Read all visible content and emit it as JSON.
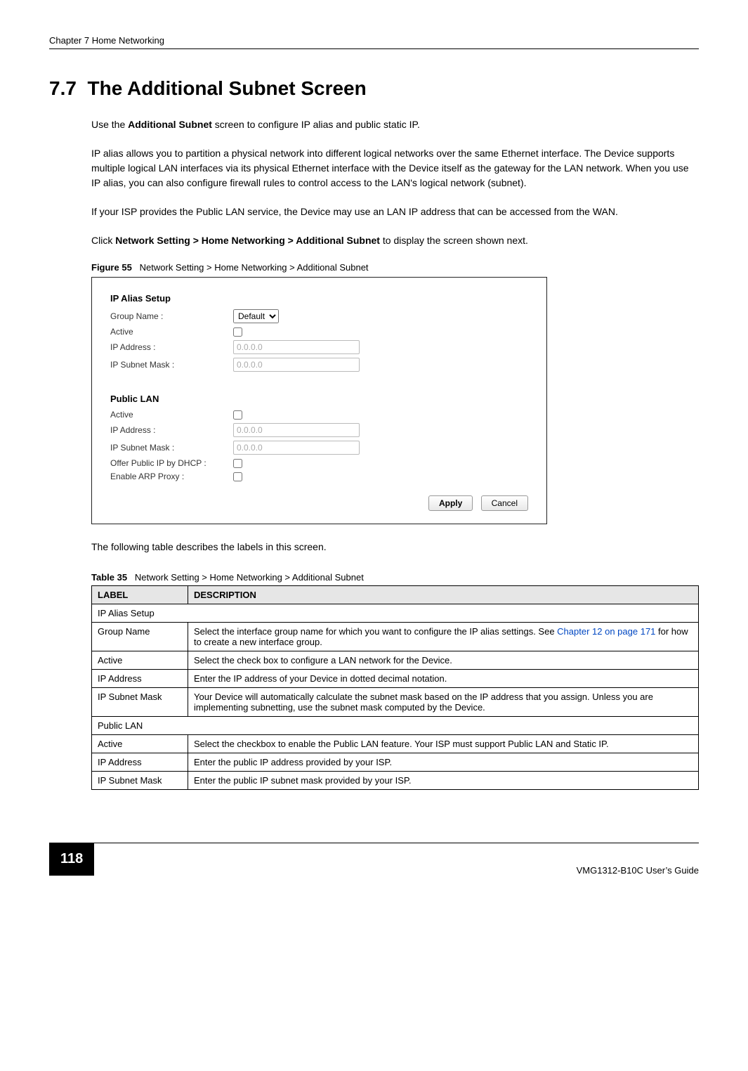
{
  "header": {
    "chapter": "Chapter 7 Home Networking"
  },
  "section": {
    "number": "7.7",
    "title": "The Additional Subnet Screen"
  },
  "paras": {
    "p1a": "Use the ",
    "p1b": "Additional Subnet",
    "p1c": " screen to configure IP alias and public static IP.",
    "p2": "IP alias allows you to partition a physical network into different logical networks over the same Ethernet interface. The Device supports multiple logical LAN interfaces via its physical Ethernet interface with the Device itself as the gateway for the LAN network. When you use IP alias, you can also configure firewall rules to control access to the LAN's logical network (subnet).",
    "p3": "If your ISP provides the Public LAN service, the Device may use an LAN IP address that can be accessed from the WAN.",
    "p4a": "Click ",
    "p4b": "Network Setting > Home Networking > Additional Subnet",
    "p4c": " to display the screen shown next.",
    "after_fig": "The following table describes the labels in this screen."
  },
  "figure": {
    "label": "Figure 55",
    "caption": "Network Setting > Home Networking > Additional Subnet"
  },
  "screenshot": {
    "ipalias": {
      "title": "IP Alias Setup",
      "group_name_label": "Group Name :",
      "group_name_value": "Default",
      "active_label": "Active",
      "active_checked": false,
      "ip_label": "IP Address :",
      "ip_value": "0.0.0.0",
      "mask_label": "IP Subnet Mask :",
      "mask_value": "0.0.0.0"
    },
    "publiclan": {
      "title": "Public LAN",
      "active_label": "Active",
      "active_checked": false,
      "ip_label": "IP Address :",
      "ip_value": "0.0.0.0",
      "mask_label": "IP Subnet Mask :",
      "mask_value": "0.0.0.0",
      "dhcp_label": "Offer Public IP by DHCP :",
      "dhcp_checked": false,
      "arp_label": "Enable ARP Proxy :",
      "arp_checked": false
    },
    "buttons": {
      "apply": "Apply",
      "cancel": "Cancel"
    }
  },
  "table": {
    "label": "Table 35",
    "caption": "Network Setting > Home Networking > Additional Subnet",
    "head": {
      "c1": "LABEL",
      "c2": "DESCRIPTION"
    },
    "rows": [
      {
        "c1": "IP Alias Setup",
        "c2": "",
        "span": true
      },
      {
        "c1": "Group Name",
        "c2a": "Select the interface group name for which you want to configure the IP alias settings. See ",
        "link": "Chapter 12 on page 171",
        "c2b": " for how to create a new interface group."
      },
      {
        "c1": "Active",
        "c2": "Select the check box to configure a LAN network for the Device."
      },
      {
        "c1": "IP Address",
        "c2": "Enter the IP address of your Device in dotted decimal notation."
      },
      {
        "c1": "IP Subnet Mask",
        "c2": "Your Device will automatically calculate the subnet mask based on the IP address that you assign. Unless you are implementing subnetting, use the subnet mask computed by the Device."
      },
      {
        "c1": "Public LAN",
        "c2": "",
        "span": true
      },
      {
        "c1": "Active",
        "c2": "Select the checkbox to enable the Public LAN feature. Your ISP must support Public LAN and Static IP."
      },
      {
        "c1": "IP Address",
        "c2": "Enter the public IP address provided by your ISP."
      },
      {
        "c1": "IP Subnet Mask",
        "c2": "Enter the public IP subnet mask provided by your ISP."
      }
    ]
  },
  "footer": {
    "page": "118",
    "guide": "VMG1312-B10C User’s Guide"
  }
}
